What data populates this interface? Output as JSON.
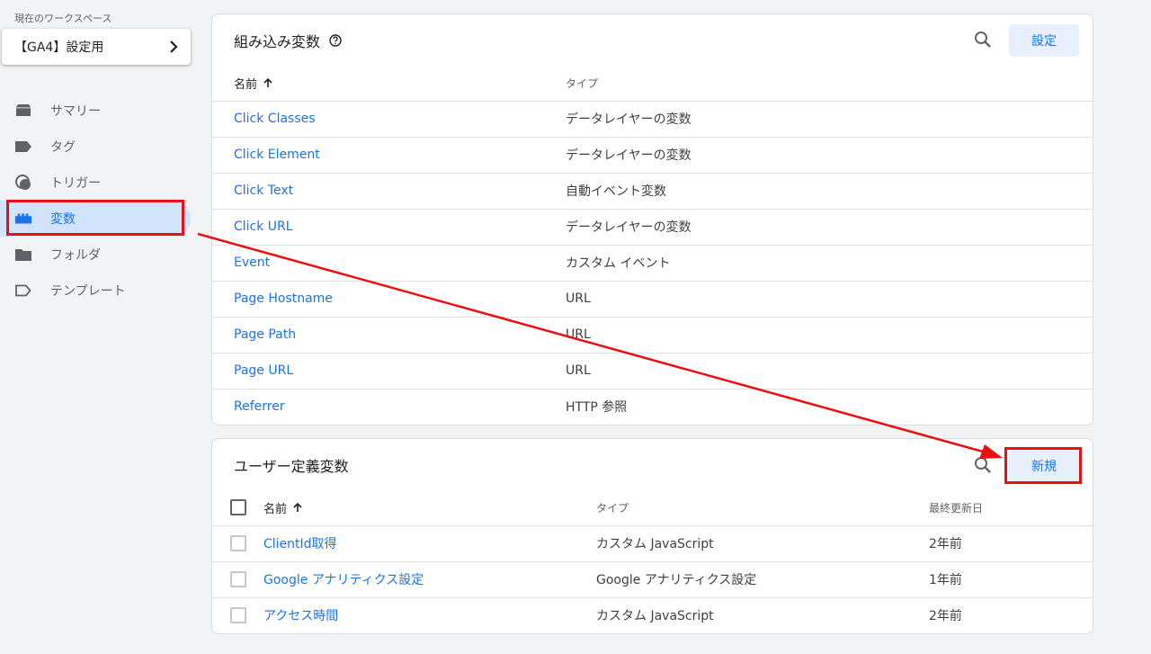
{
  "sidebar": {
    "workspace_label": "現在のワークスペース",
    "workspace_name": "【GA4】設定用",
    "items": [
      {
        "label": "サマリー",
        "icon": "summary-icon"
      },
      {
        "label": "タグ",
        "icon": "tag-icon"
      },
      {
        "label": "トリガー",
        "icon": "trigger-icon"
      },
      {
        "label": "変数",
        "icon": "variables-icon",
        "active": true
      },
      {
        "label": "フォルダ",
        "icon": "folder-icon"
      },
      {
        "label": "テンプレート",
        "icon": "template-icon"
      }
    ]
  },
  "builtin": {
    "title": "組み込み変数",
    "configure_label": "設定",
    "columns": {
      "name": "名前",
      "type": "タイプ"
    },
    "rows": [
      {
        "name": "Click Classes",
        "type": "データレイヤーの変数"
      },
      {
        "name": "Click Element",
        "type": "データレイヤーの変数"
      },
      {
        "name": "Click Text",
        "type": "自動イベント変数"
      },
      {
        "name": "Click URL",
        "type": "データレイヤーの変数"
      },
      {
        "name": "Event",
        "type": "カスタム イベント"
      },
      {
        "name": "Page Hostname",
        "type": "URL"
      },
      {
        "name": "Page Path",
        "type": "URL"
      },
      {
        "name": "Page URL",
        "type": "URL"
      },
      {
        "name": "Referrer",
        "type": "HTTP 参照"
      }
    ]
  },
  "user_defined": {
    "title": "ユーザー定義変数",
    "new_label": "新規",
    "columns": {
      "name": "名前",
      "type": "タイプ",
      "updated": "最終更新日"
    },
    "rows": [
      {
        "name": "ClientId取得",
        "type": "カスタム JavaScript",
        "updated": "2年前"
      },
      {
        "name": "Google アナリティクス設定",
        "type": "Google アナリティクス設定",
        "updated": "1年前"
      },
      {
        "name": "アクセス時間",
        "type": "カスタム JavaScript",
        "updated": "2年前"
      }
    ]
  },
  "colors": {
    "accent": "#1a73e8",
    "annotation": "#e8110f",
    "active_bg": "#d2e3fc"
  }
}
